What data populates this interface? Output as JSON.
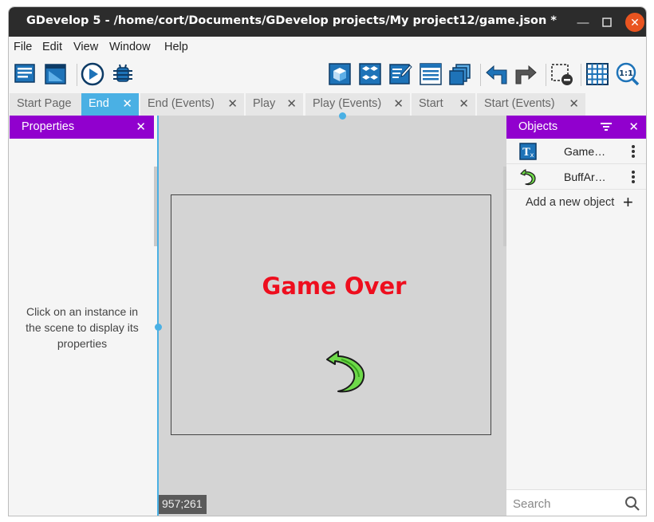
{
  "window": {
    "title": "GDevelop 5 - /home/cort/Documents/GDevelop projects/My project12/game.json *"
  },
  "menu": [
    "File",
    "Edit",
    "View",
    "Window",
    "Help"
  ],
  "toolbar": {
    "left": [
      "project-manager-icon",
      "scene-editor-icon",
      "preview-play-icon",
      "debugger-icon"
    ],
    "right": [
      "object-cube-icon",
      "object-groups-icon",
      "properties-edit-icon",
      "instances-list-icon",
      "layers-icon",
      "undo-icon",
      "redo-icon",
      "delete-selection-icon",
      "grid-icon",
      "zoom-reset-icon"
    ]
  },
  "tabs": [
    {
      "label": "Start Page",
      "closable": false
    },
    {
      "label": "End",
      "closable": true,
      "active": true
    },
    {
      "label": "End (Events)",
      "closable": true
    },
    {
      "label": "Play",
      "closable": true
    },
    {
      "label": "Play (Events)",
      "closable": true
    },
    {
      "label": "Start",
      "closable": true
    },
    {
      "label": "Start (Events)",
      "closable": true
    }
  ],
  "properties": {
    "title": "Properties",
    "hint": "Click on an instance in the scene to display its properties"
  },
  "scene": {
    "text": "Game Over",
    "text_color": "#ee0e1e",
    "coords": "957;261"
  },
  "objects": {
    "title": "Objects",
    "items": [
      {
        "name": "Game…",
        "icon": "text-object-icon"
      },
      {
        "name": "BuffAr…",
        "icon": "sprite-object-icon"
      }
    ],
    "add_label": "Add a new object",
    "search_placeholder": "Search"
  },
  "colors": {
    "accent": "#9100ce",
    "tab_active": "#4ab0e4",
    "titlebar": "#2c2c2c",
    "close": "#e95420"
  }
}
